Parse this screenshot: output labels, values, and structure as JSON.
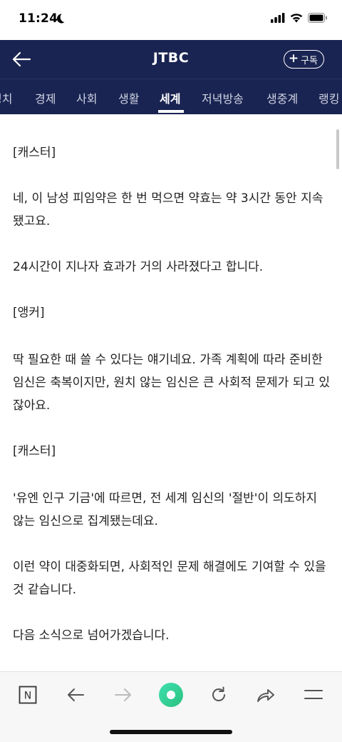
{
  "status_bar": {
    "time": "11:24"
  },
  "header": {
    "title": "JTBC",
    "subscribe_label": "구독",
    "subscribe_plus": "+"
  },
  "tabs": [
    "정치",
    "경제",
    "사회",
    "생활",
    "세계",
    "저녁방송",
    "생중계",
    "랭킹"
  ],
  "active_tab": "세계",
  "article": {
    "paragraphs": [
      "[캐스터]",
      "네, 이 남성 피임약은 한 번 먹으면 약효는 약 3시간 동안 지속됐고요.",
      "24시간이 지나자 효과가 거의 사라졌다고 합니다.",
      "[앵커]",
      "딱 필요한 때 쓸 수 있다는 얘기네요. 가족 계획에 따라 준비한 임신은 축복이지만, 원치 않는 임신은 큰 사회적 문제가 되고 있잖아요.",
      "[캐스터]",
      "'유엔 인구 기금'에 따르면, 전 세계 임신의 '절반'이 의도하지 않는 임신으로 집계됐는데요.",
      "이런 약이 대중화되면, 사회적인 문제 해결에도 기여할 수 있을 것 같습니다.",
      "다음 소식으로 넘어가겠습니다."
    ]
  },
  "bottom_bar": {
    "icons": [
      "naver-home-icon",
      "back-arrow-icon",
      "forward-arrow-icon",
      "green-dot-icon",
      "refresh-icon",
      "share-icon",
      "menu-icon"
    ],
    "naver_letter": "N"
  },
  "colors": {
    "header_bg": "#1a2452",
    "accent_green": "#3fd6a0"
  }
}
